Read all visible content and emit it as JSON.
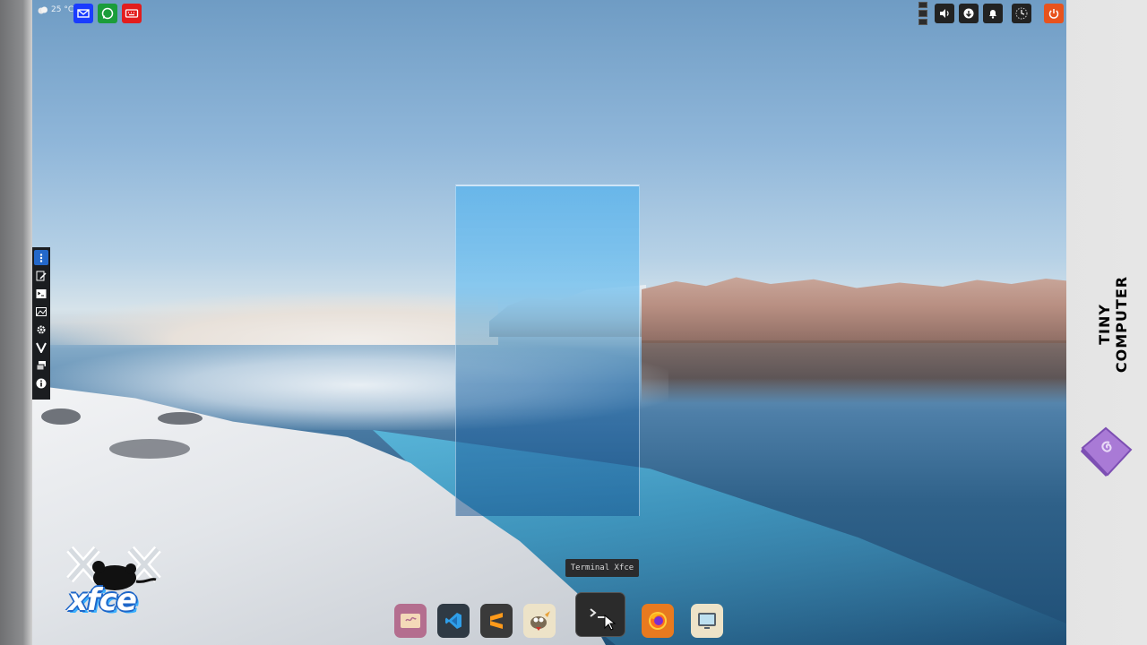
{
  "top_panel": {
    "left_label": "25 °C",
    "left_icons": [
      {
        "name": "email-icon",
        "color": "#1a3cff"
      },
      {
        "name": "whatsapp-icon",
        "color": "#1b9d3a"
      },
      {
        "name": "keyboard-icon",
        "color": "#e21d1d"
      }
    ],
    "right_icons": [
      "volume-icon",
      "network-icon",
      "notification-icon",
      "clock-icon",
      "power-icon"
    ],
    "power_color": "#e8531d"
  },
  "launcher": {
    "items": [
      "menu-icon",
      "text-editor-icon",
      "terminal-icon",
      "image-viewer-icon",
      "settings-icon",
      "vim-icon",
      "windows-icon",
      "info-icon"
    ]
  },
  "dock": {
    "items": [
      "file-manager-icon",
      "vscode-icon",
      "sublime-text-icon",
      "gimp-icon",
      "terminal-icon",
      "firefox-icon",
      "monitor-icon"
    ],
    "tooltip": "Terminal Xfce"
  },
  "branding": {
    "vertical_text": "TINY COMPUTER",
    "logo_text": "xfce"
  }
}
